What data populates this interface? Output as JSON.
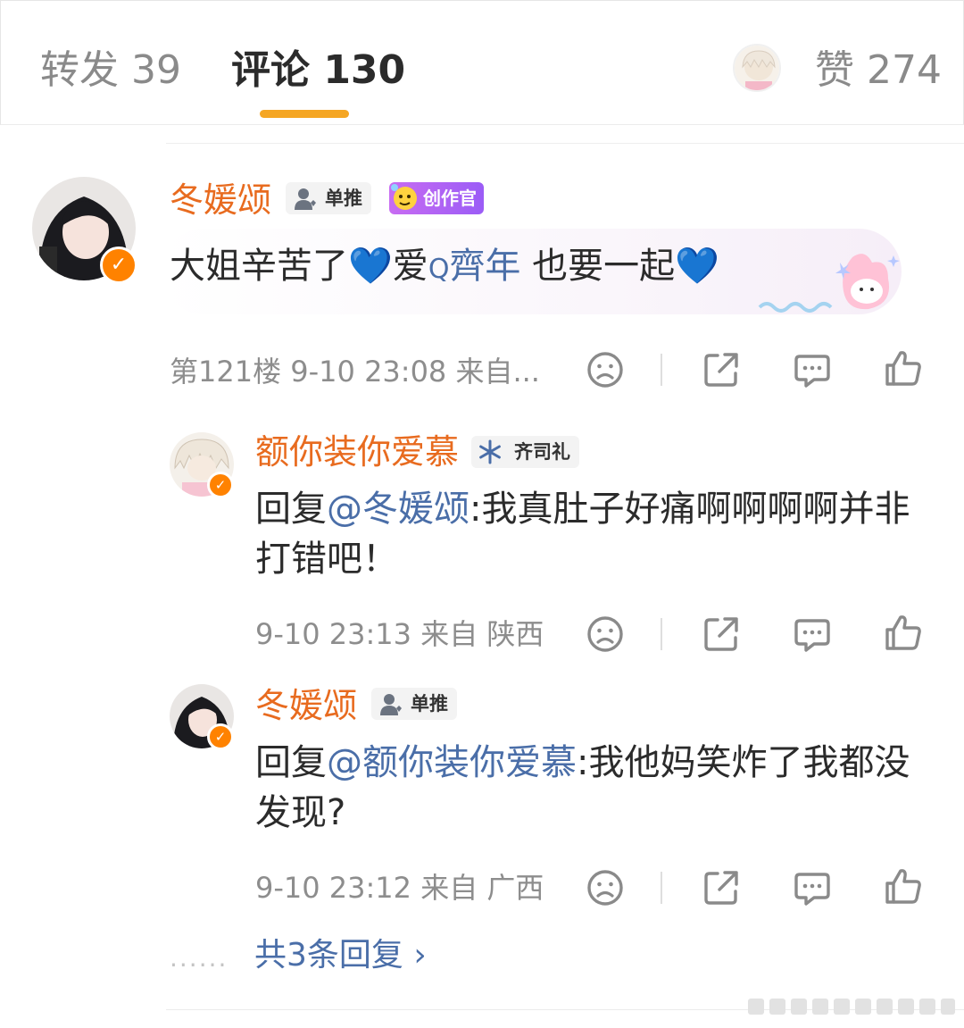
{
  "tabs": {
    "repost": "转发 39",
    "comment": "评论 130",
    "like": "赞 274"
  },
  "comments": [
    {
      "username": "冬媛颂",
      "badge": "单推",
      "creator_badge": "创作官",
      "text_before": "大姐辛苦了💙爱",
      "topic_icon": "Q",
      "topic": "齊年",
      "text_after": " 也要一起💙",
      "floor": "第121楼",
      "time": "9-10 23:08",
      "source": "来自..."
    }
  ],
  "replies": [
    {
      "username": "额你装你爱慕",
      "badge": "齐司礼",
      "reply_prefix": "回复",
      "mention": "@冬媛颂",
      "text": ":我真肚子好痛啊啊啊啊并非打错吧！",
      "time": "9-10 23:13",
      "source": "来自 陕西"
    },
    {
      "username": "冬媛颂",
      "badge": "单推",
      "reply_prefix": "回复",
      "mention": "@额你装你爱慕",
      "text": ":我他妈笑炸了我都没发现?",
      "time": "9-10 23:12",
      "source": "来自 广西"
    }
  ],
  "more": {
    "dots": "......",
    "label": "共3条回复 ›"
  },
  "colors": {
    "accent": "#f5a623",
    "username": "#e86b1f",
    "link": "#4a6ea8",
    "meta": "#8d8d8d"
  },
  "icons": [
    "dislike-icon",
    "share-icon",
    "comment-icon",
    "like-icon",
    "verified-icon"
  ]
}
